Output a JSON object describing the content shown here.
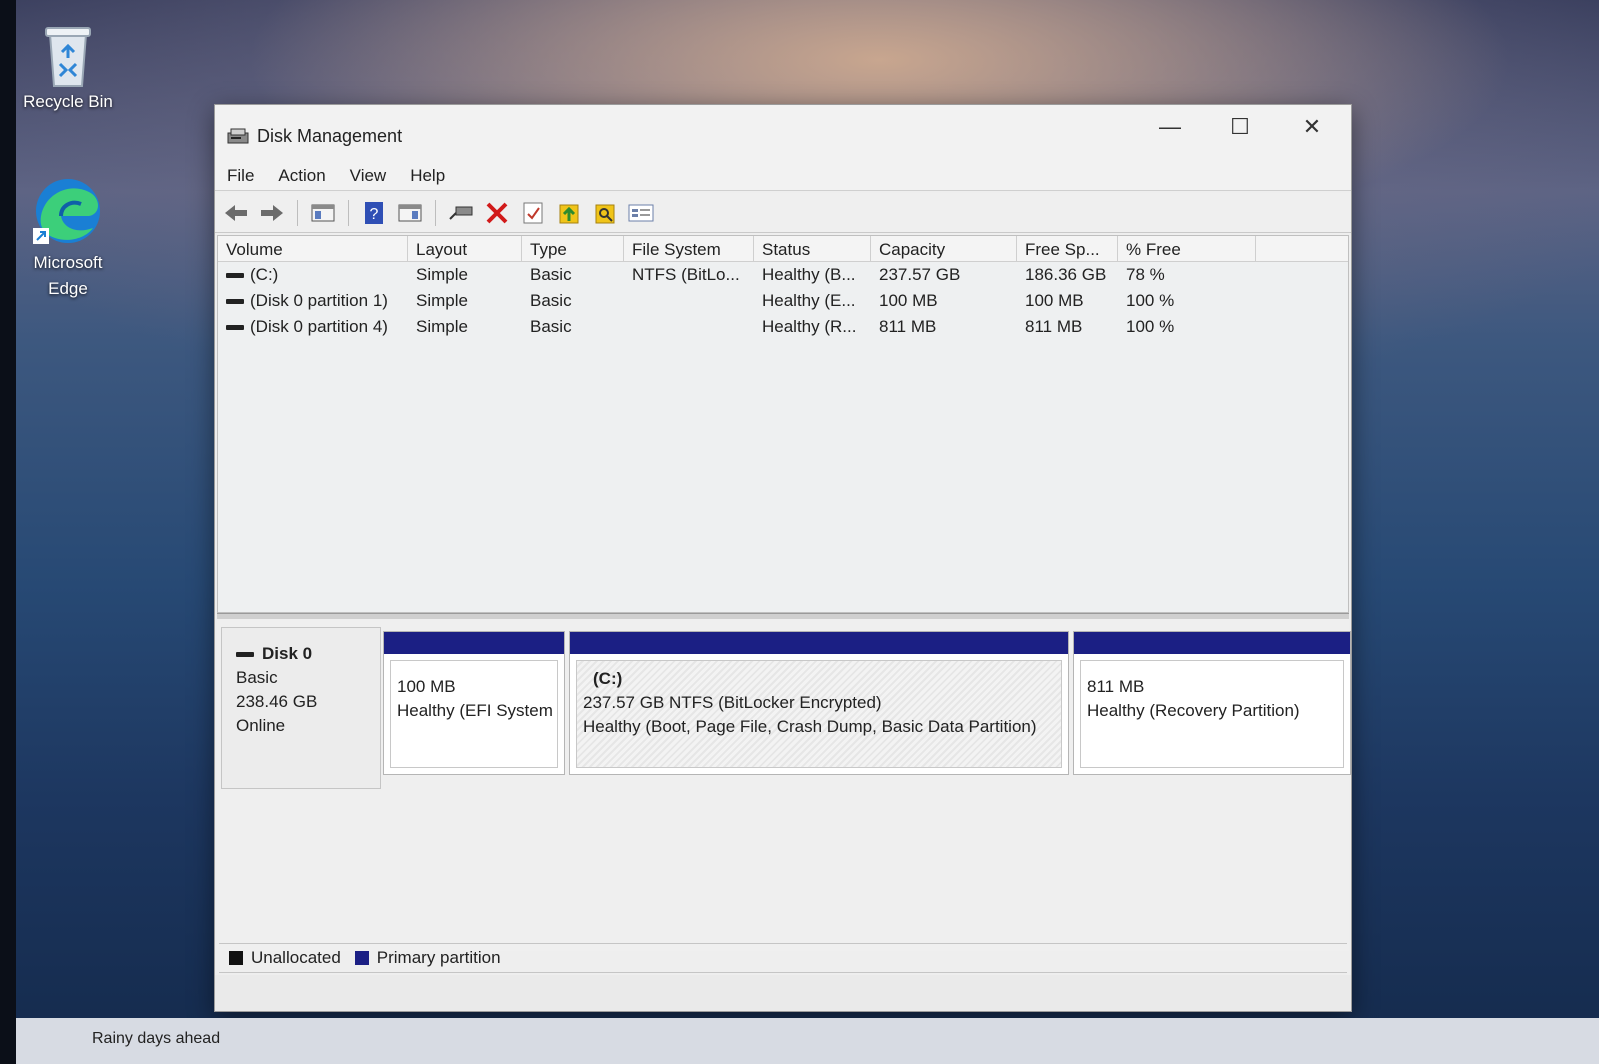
{
  "desktop": {
    "icons": [
      {
        "label": "Recycle Bin",
        "icon": "recycle-bin-icon"
      },
      {
        "label": "Microsoft Edge",
        "icon": "edge-icon"
      }
    ]
  },
  "window": {
    "title": "Disk Management",
    "controls": {
      "minimize": "—",
      "maximize": "☐",
      "close": "✕"
    }
  },
  "menu": [
    "File",
    "Action",
    "View",
    "Help"
  ],
  "toolbar": [
    "back-arrow-icon",
    "forward-arrow-icon",
    "console-tree-icon",
    "help-icon",
    "show-hide-icon",
    "connect-icon",
    "delete-icon",
    "checklist-icon",
    "export-icon",
    "find-icon",
    "properties-icon"
  ],
  "volumes": {
    "headers": [
      "Volume",
      "Layout",
      "Type",
      "File System",
      "Status",
      "Capacity",
      "Free Sp...",
      "% Free"
    ],
    "rows": [
      [
        "(C:)",
        "Simple",
        "Basic",
        "NTFS (BitLo...",
        "Healthy (B...",
        "237.57 GB",
        "186.36 GB",
        "78 %"
      ],
      [
        "(Disk 0 partition 1)",
        "Simple",
        "Basic",
        "",
        "Healthy (E...",
        "100 MB",
        "100 MB",
        "100 %"
      ],
      [
        "(Disk 0 partition 4)",
        "Simple",
        "Basic",
        "",
        "Healthy (R...",
        "811 MB",
        "811 MB",
        "100 %"
      ]
    ]
  },
  "disk": {
    "name": "Disk 0",
    "type": "Basic",
    "size": "238.46 GB",
    "state": "Online",
    "partitions": [
      {
        "title": "",
        "line1": "100 MB",
        "line2": "Healthy (EFI System"
      },
      {
        "title": "(C:)",
        "line1": "237.57 GB NTFS (BitLocker Encrypted)",
        "line2": "Healthy (Boot, Page File, Crash Dump, Basic Data Partition)"
      },
      {
        "title": "",
        "line1": "811 MB",
        "line2": "Healthy (Recovery Partition)"
      }
    ]
  },
  "legend": {
    "unallocated": "Unallocated",
    "primary": "Primary partition"
  },
  "colors": {
    "primary_partition": "#1b1f84",
    "unallocated": "#111111"
  },
  "taskbar": {
    "weather_text": "Rainy days ahead"
  }
}
